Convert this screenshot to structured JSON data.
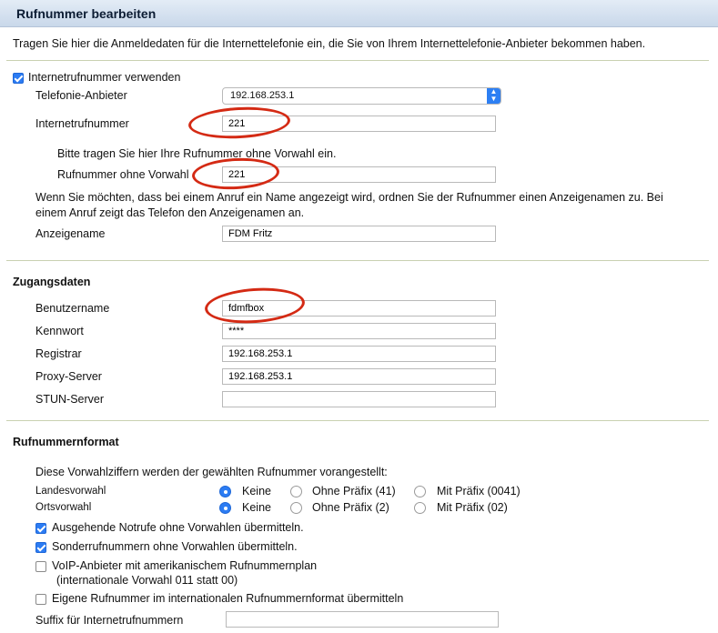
{
  "header": {
    "title": "Rufnummer bearbeiten"
  },
  "intro": "Tragen Sie hier die Anmeldedaten für die Internettelefonie ein, die Sie von Ihrem Internettelefonie-Anbieter bekommen haben.",
  "internet_number": {
    "use_label": "Internetrufnummer verwenden",
    "use_checked": true,
    "provider_label": "Telefonie-Anbieter",
    "provider_value": "192.168.253.1",
    "number_label": "Internetrufnummer",
    "number_value": "221",
    "hint": "Bitte tragen Sie hier Ihre Rufnummer ohne Vorwahl ein.",
    "no_prefix_label": "Rufnummer ohne Vorwahl",
    "no_prefix_value": "221",
    "display_info_line1": "Wenn Sie möchten, dass bei einem Anruf ein Name angezeigt wird, ordnen Sie der Rufnummer einen Anzeigenamen zu. Bei",
    "display_info_line2": "einem Anruf zeigt das Telefon den Anzeigenamen an.",
    "display_name_label": "Anzeigename",
    "display_name_value": "FDM Fritz"
  },
  "access": {
    "heading": "Zugangsdaten",
    "username_label": "Benutzername",
    "username_value": "fdmfbox",
    "password_label": "Kennwort",
    "password_value": "****",
    "registrar_label": "Registrar",
    "registrar_value": "192.168.253.1",
    "proxy_label": "Proxy-Server",
    "proxy_value": "192.168.253.1",
    "stun_label": "STUN-Server",
    "stun_value": ""
  },
  "format": {
    "heading": "Rufnummernformat",
    "prefix_info": "Diese Vorwahlziffern werden der gewählten Rufnummer vorangestellt:",
    "country_label": "Landesvorwahl",
    "country_options": [
      "Keine",
      "Ohne Präfix (41)",
      "Mit Präfix (0041)"
    ],
    "country_selected": "Keine",
    "area_label": "Ortsvorwahl",
    "area_options": [
      "Keine",
      "Ohne Präfix (2)",
      "Mit Präfix (02)"
    ],
    "area_selected": "Keine",
    "checkboxes": [
      {
        "label": "Ausgehende Notrufe ohne Vorwahlen übermitteln.",
        "checked": true
      },
      {
        "label": "Sonderrufnummern ohne Vorwahlen übermitteln.",
        "checked": true
      },
      {
        "label": "VoIP-Anbieter mit amerikanischem Rufnummernplan",
        "label2": "(internationale Vorwahl 011 statt 00)",
        "checked": false
      },
      {
        "label": "Eigene Rufnummer im internationalen Rufnummernformat übermitteln",
        "checked": false
      }
    ],
    "suffix_label": "Suffix für Internetrufnummern",
    "suffix_value": ""
  },
  "colors": {
    "accent": "#2c7cf3",
    "highlight": "#d42a14",
    "header": "#c9d8ea"
  }
}
